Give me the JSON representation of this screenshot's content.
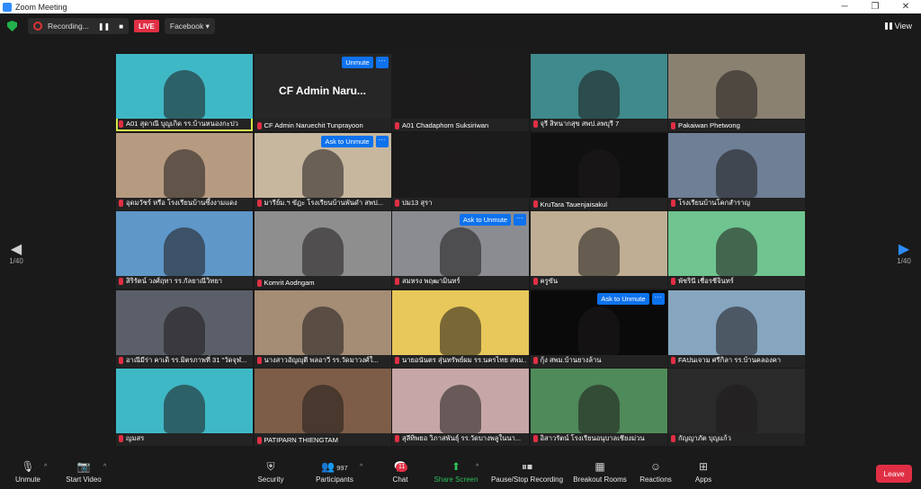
{
  "window": {
    "title": "Zoom Meeting"
  },
  "topbar": {
    "recording": "Recording...",
    "rec_pause": "❚❚",
    "rec_stop": "■",
    "live": "LIVE",
    "stream_target": "Facebook ▾",
    "view": "View"
  },
  "grid": {
    "tiles": [
      {
        "name": "A01 สุดาณี บุญเกิด รร.บ้านหนองกะปว",
        "kind": "person",
        "bg": "#3fb8c6",
        "active": true
      },
      {
        "name": "CF Admin Naruechit Tunprayoon",
        "kind": "text",
        "big_name": "CF Admin Naru...",
        "bg": "#262626",
        "hover": "Unmute"
      },
      {
        "name": "A01 Chadaphorn Suksiriwan",
        "kind": "person",
        "bg": "#1b1b1b"
      },
      {
        "name": "จุรี สิทนากสุข สพป.ลพบุรี 7",
        "kind": "person",
        "bg": "#3f8a8c"
      },
      {
        "name": "Pakaiwan Phetwong",
        "kind": "person",
        "bg": "#8a8171"
      },
      {
        "name": "อุดมวัชร์ หรือ โรงเรียนบ้านซึ้งงามแดง",
        "kind": "person",
        "bg": "#b79b81"
      },
      {
        "name": "มารีย์ม.ฯ ขัฎะ โรงเรียนบ้านพันดำ สพป...",
        "kind": "person",
        "bg": "#c7b79f",
        "hover": "Ask to Unmute"
      },
      {
        "name": "ปม13 สุรา",
        "kind": "person",
        "bg": "#1b1b1b"
      },
      {
        "name": "KruTara Tauenjaisakul",
        "kind": "person",
        "bg": "#101010"
      },
      {
        "name": "โรงเรียนบ้านโคกสำราญ",
        "kind": "person",
        "bg": "#6e7f96"
      },
      {
        "name": "สิริรัตน์ วงศ์ฤทา รร.กัลยาณีวิทยา",
        "kind": "person",
        "bg": "#5f97c8"
      },
      {
        "name": "Komrit Aodngam",
        "kind": "person",
        "bg": "#8e8e8e"
      },
      {
        "name": "สมหรง พฤฒามินทร์",
        "kind": "person",
        "bg": "#8a8c92",
        "hover": "Ask to Unmute"
      },
      {
        "name": "ครูขัน",
        "kind": "person",
        "bg": "#bfae93"
      },
      {
        "name": "พัชรินี เชื่อรชีจินทร์",
        "kind": "person",
        "bg": "#6fc48f"
      },
      {
        "name": "อาณีมีร่า คาเดิ รร.มิตรภาพที่ 31 \"วัดจุฬ...",
        "kind": "person",
        "bg": "#5b5f6a"
      },
      {
        "name": "นางสาวอัญญุตี พลอาวี รร.วัดมาวงศ์ใ...",
        "kind": "person",
        "bg": "#a58c75"
      },
      {
        "name": "นายอนันตร สุ่นทรัพย์ผม รร.นครไทย สพม...",
        "kind": "person",
        "bg": "#e8c85a"
      },
      {
        "name": "กุ้ง สพม.บ้านยางล้าน",
        "kind": "person",
        "bg": "#0a0a0a",
        "hover": "Ask to Unmute"
      },
      {
        "name": "FAปนเจาม ศรีกิลา รร.บ้านคลองคา",
        "kind": "person",
        "bg": "#86a6c0"
      },
      {
        "name": "ญมสร",
        "kind": "person",
        "bg": "#3fb8c6"
      },
      {
        "name": "PATIPARN THIENGTAM",
        "kind": "person",
        "bg": "#7e5d48"
      },
      {
        "name": "สุลีทิพยอ วิภาสพันธุ์ รร.วัดบางพลูในนา...",
        "kind": "person",
        "bg": "#c6a6a6"
      },
      {
        "name": "อิสาวรัตน์ โรงเรียนอนุบาลเชียงม่วน",
        "kind": "person",
        "bg": "#4f8a5a"
      },
      {
        "name": "กัญญาภัต บุญแก้ว",
        "kind": "person",
        "bg": "#2a2a2a"
      }
    ]
  },
  "nav": {
    "page_left": "1/40",
    "page_right": "1/40"
  },
  "toolbar": {
    "unmute": "Unmute",
    "start_video": "Start Video",
    "security": "Security",
    "participants": "Participants",
    "participants_count": "997",
    "chat": "Chat",
    "chat_badge": "11",
    "share": "Share Screen",
    "recording": "Pause/Stop Recording",
    "breakout": "Breakout Rooms",
    "reactions": "Reactions",
    "apps": "Apps",
    "leave": "Leave"
  }
}
